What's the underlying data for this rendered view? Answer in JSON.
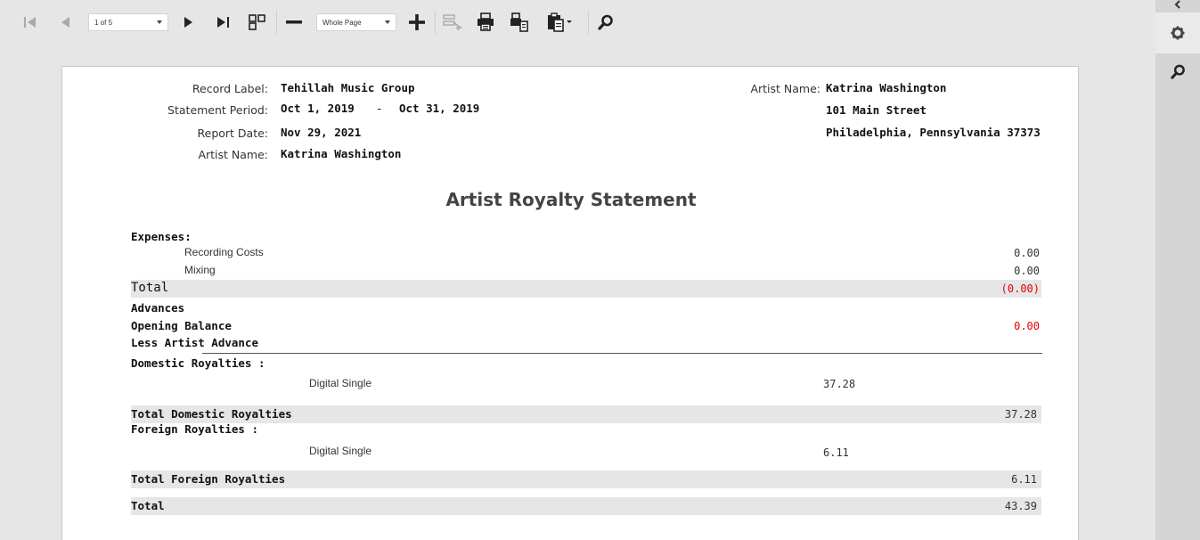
{
  "toolbar": {
    "page_indicator": "1 of 5",
    "zoom_select": "Whole Page"
  },
  "header": {
    "record_label_label": "Record Label:",
    "record_label_value": "Tehillah Music Group",
    "statement_period_label": "Statement Period:",
    "period_start": "Oct 1, 2019",
    "period_dash": "-",
    "period_end": "Oct 31, 2019",
    "report_date_label": "Report Date:",
    "report_date_value": "Nov 29, 2021",
    "artist_name_label": "Artist Name:",
    "artist_name_value": "Katrina Washington",
    "right_artist_label": "Artist Name:",
    "right_artist_value": "Katrina Washington",
    "address_line1": "101 Main Street",
    "address_line2": "Philadelphia, Pennsylvania 37373"
  },
  "report_title": "Artist Royalty Statement",
  "expenses": {
    "heading": "Expenses:",
    "items": [
      {
        "label": "Recording Costs",
        "value": "0.00"
      },
      {
        "label": "Mixing",
        "value": "0.00"
      }
    ],
    "total_label": "Total",
    "total_value": "(0.00)"
  },
  "advances": {
    "heading": "Advances",
    "opening_balance_label": "Opening Balance",
    "opening_balance_value": "0.00",
    "less_artist_advance_label": "Less Artist Advance"
  },
  "domestic": {
    "heading": "Domestic Royalties :",
    "item_label": "Digital Single",
    "item_value": "37.28",
    "total_label": "Total Domestic Royalties",
    "total_value": "37.28"
  },
  "foreign": {
    "heading": "Foreign Royalties :",
    "item_label": "Digital Single",
    "item_value": "6.11",
    "total_label": "Total Foreign Royalties",
    "total_value": "6.11"
  },
  "grand_total": {
    "label": "Total",
    "value": "43.39"
  },
  "colors": {
    "negative": "#e00000",
    "band": "#e6e6e6"
  }
}
